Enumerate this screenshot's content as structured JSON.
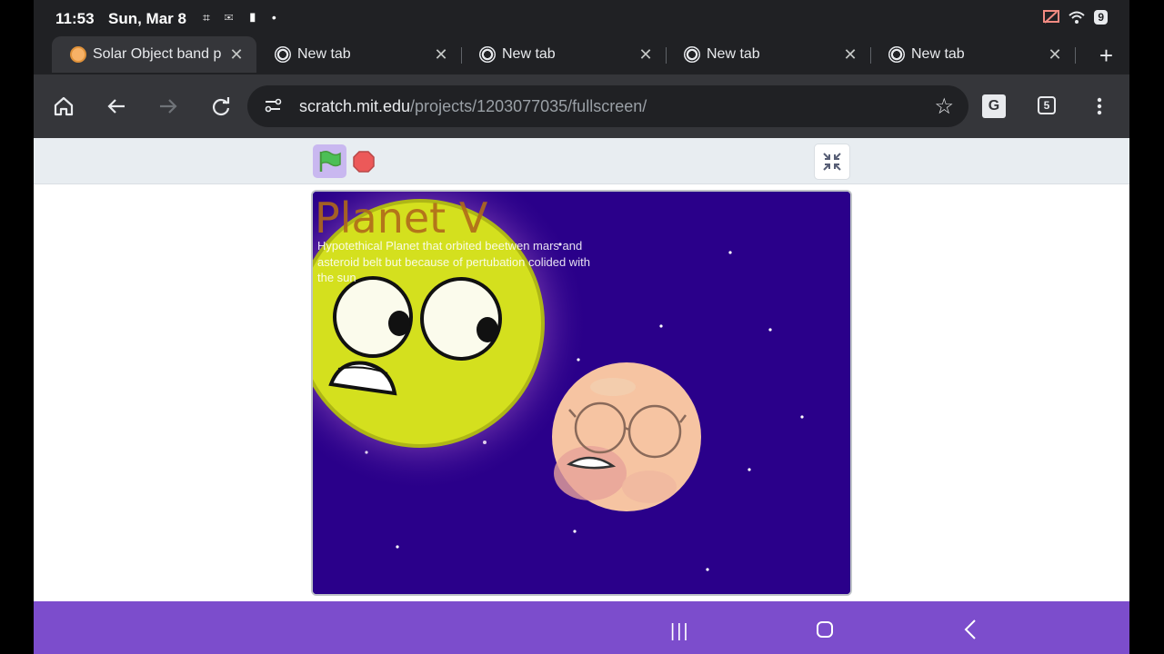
{
  "status": {
    "time": "11:53",
    "date": "Sun, Mar 8",
    "notification_icons": "⌗ ✉ ▮ •",
    "battery": "9"
  },
  "tabs": [
    {
      "title": "Solar Object band p",
      "favicon": "scratch-cat-icon",
      "active": true
    },
    {
      "title": "New tab",
      "favicon": "chrome-icon",
      "active": false
    },
    {
      "title": "New tab",
      "favicon": "chrome-icon",
      "active": false
    },
    {
      "title": "New tab",
      "favicon": "chrome-icon",
      "active": false
    },
    {
      "title": "New tab",
      "favicon": "chrome-icon",
      "active": false
    }
  ],
  "toolbar": {
    "url_host": "scratch.mit.edu",
    "url_path": "/projects/1203077035/fullscreen/",
    "tab_count": "5"
  },
  "stage": {
    "title": "Planet V",
    "description": "Hypotethical Planet that orbited beetwen mars and asteroid belt but because of pertubation colided with the sun",
    "background_color": "#2a008a",
    "sun_color": "#d4e01e",
    "planet_color": "#f6c4a2"
  }
}
